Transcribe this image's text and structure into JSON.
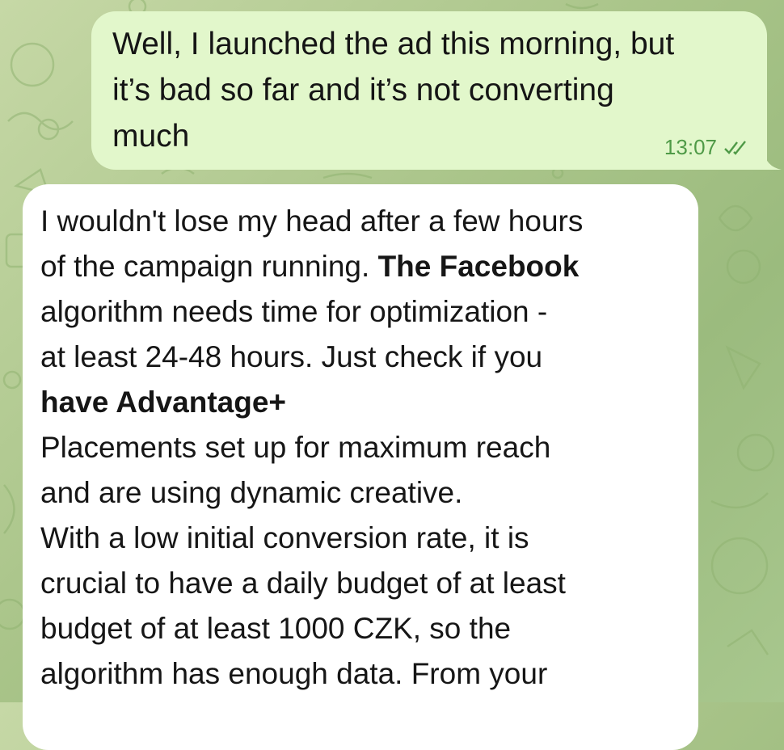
{
  "conversation": {
    "outgoing_message": {
      "lines": [
        "Well, I launched the ad this morning, but",
        "it’s bad so far and it’s not converting",
        "much"
      ],
      "time": "13:07",
      "status_icon": "double-check-icon"
    },
    "incoming_message": {
      "segments": [
        {
          "text": "I wouldn't lose my head after a few hours",
          "bold": false
        },
        {
          "text_a": "of the campaign running. ",
          "text_b": "The Facebook"
        },
        {
          "text": "algorithm needs time for optimization -",
          "bold": false
        },
        {
          "text": "at least 24-48 hours. Just check if you",
          "bold": false
        },
        {
          "text": "have Advantage+",
          "bold": true
        },
        {
          "text": "Placements set up for maximum reach",
          "bold": false
        },
        {
          "text": "and are using dynamic creative.",
          "bold": false
        },
        {
          "text": "With a low initial conversion rate, it is",
          "bold": false
        },
        {
          "text": "crucial to have a daily budget of at least",
          "bold": false
        },
        {
          "text": "budget of at least 1000 CZK, so the",
          "bold": false
        },
        {
          "text": "algorithm has enough data. From your",
          "bold": false
        }
      ]
    }
  },
  "colors": {
    "outgoing_bubble": "#e2f7cb",
    "incoming_bubble": "#ffffff",
    "timestamp": "#4f9a47",
    "background": "#a9c489"
  }
}
